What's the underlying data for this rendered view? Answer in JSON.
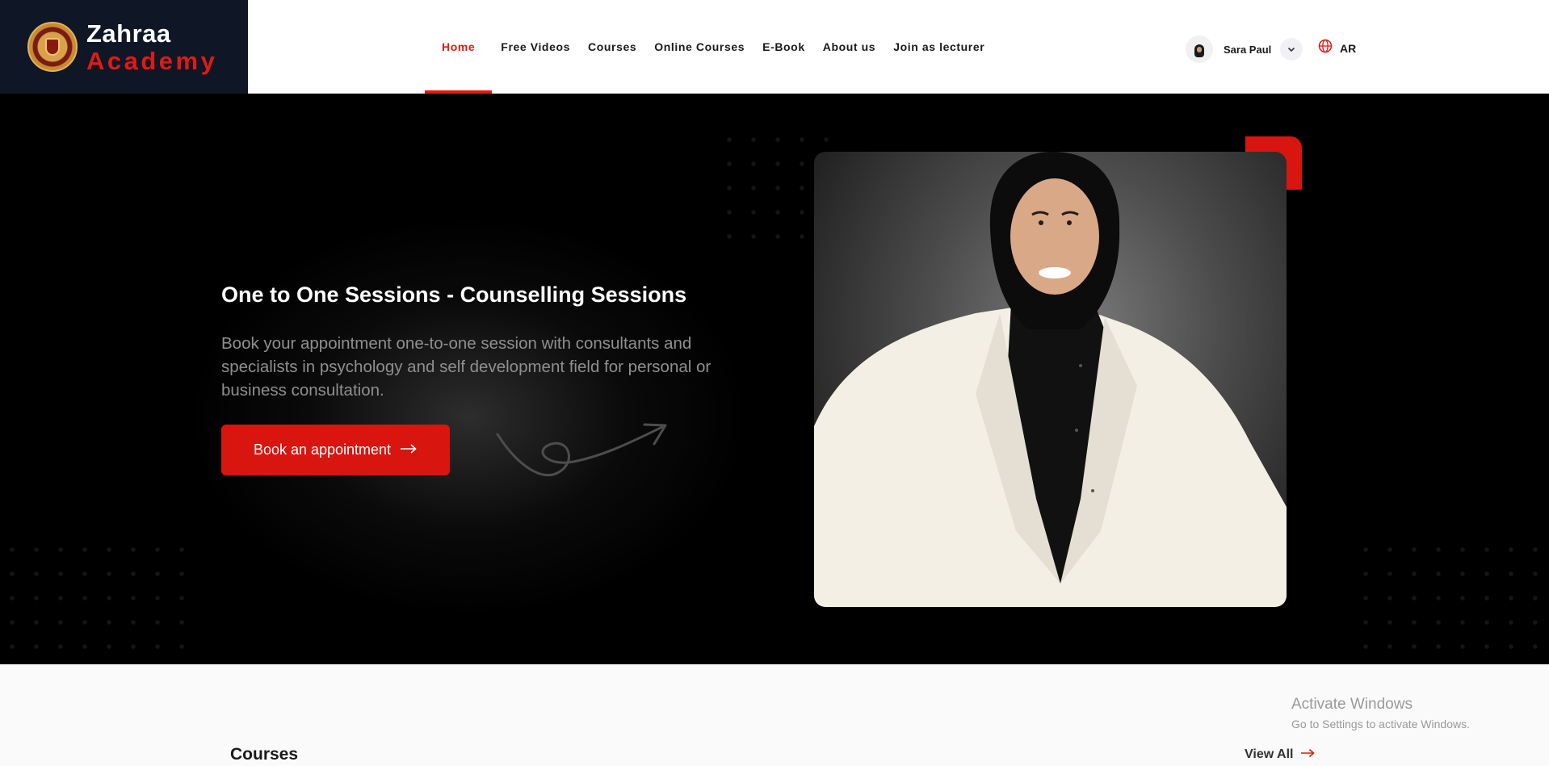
{
  "brand": {
    "line1": "Zahraa",
    "line2": "Academy"
  },
  "nav": {
    "items": [
      {
        "label": "Home",
        "active": true
      },
      {
        "label": "Free Videos"
      },
      {
        "label": "Courses"
      },
      {
        "label": "Online Courses"
      },
      {
        "label": "E-Book"
      },
      {
        "label": "About us"
      },
      {
        "label": "Join as lecturer"
      }
    ]
  },
  "user": {
    "name": "Sara Paul",
    "avatar_icon": "user-avatar-icon",
    "menu_icon": "chevron-down-icon"
  },
  "language": {
    "label": "AR",
    "icon": "globe-icon"
  },
  "hero": {
    "title": "One to One Sessions - Counselling Sessions",
    "description": "Book your appointment one-to-one session with consultants and specialists in psychology and self development field for personal or business consultation.",
    "cta_label": "Book an appointment",
    "cta_icon": "arrow-right-icon"
  },
  "courses": {
    "title": "Courses",
    "view_all": "View All"
  },
  "watermark": {
    "line1": "Activate Windows",
    "line2": "Go to Settings to activate Windows."
  },
  "colors": {
    "accent": "#e01a12",
    "header_logo_bg": "#0f1626",
    "hero_bg": "#000000"
  }
}
